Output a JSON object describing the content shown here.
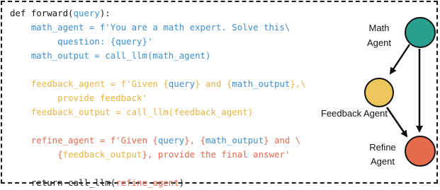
{
  "code": {
    "lines": [
      [
        {
          "t": "def forward(",
          "c": "black"
        },
        {
          "t": "query",
          "c": "blue"
        },
        {
          "t": "):",
          "c": "black"
        }
      ],
      [
        {
          "t": "    math_agent = f'You are a math expert. Solve this\\",
          "c": "blue"
        }
      ],
      [
        {
          "t": "         question: {",
          "c": "blue"
        },
        {
          "t": "query",
          "c": "blue"
        },
        {
          "t": "}'",
          "c": "blue"
        }
      ],
      [
        {
          "t": "    math_output = call_llm(math_agent)",
          "c": "blue"
        }
      ],
      [
        {
          "t": "",
          "c": "black"
        }
      ],
      [
        {
          "t": "    feedback_agent = f'Given {",
          "c": "yellow"
        },
        {
          "t": "query",
          "c": "blue"
        },
        {
          "t": "} and {",
          "c": "yellow"
        },
        {
          "t": "math_output",
          "c": "blue"
        },
        {
          "t": "},\\",
          "c": "yellow"
        }
      ],
      [
        {
          "t": "         provide feedback'",
          "c": "yellow"
        }
      ],
      [
        {
          "t": "    feedback_output = call_llm(feedback_agent)",
          "c": "yellow"
        }
      ],
      [
        {
          "t": "",
          "c": "black"
        }
      ],
      [
        {
          "t": "    refine_agent = f'Given {",
          "c": "orange"
        },
        {
          "t": "query",
          "c": "blue"
        },
        {
          "t": "}, {",
          "c": "orange"
        },
        {
          "t": "math_output",
          "c": "blue"
        },
        {
          "t": "} and \\",
          "c": "orange"
        }
      ],
      [
        {
          "t": "         {",
          "c": "orange"
        },
        {
          "t": "feedback_output",
          "c": "yellow"
        },
        {
          "t": "}, provide the final answer'",
          "c": "orange"
        }
      ],
      [
        {
          "t": "",
          "c": "black"
        }
      ],
      [
        {
          "t": "    return call_llm(",
          "c": "black"
        },
        {
          "t": "refine_agent",
          "c": "orange"
        },
        {
          "t": ")",
          "c": "black"
        }
      ]
    ]
  },
  "diagram": {
    "nodes": [
      {
        "id": "math",
        "label_lines": [
          "Math",
          "Agent"
        ],
        "color": "#27a08e"
      },
      {
        "id": "feedback",
        "label_lines": [
          "Feedback Agent"
        ],
        "color": "#ecc65a"
      },
      {
        "id": "refine",
        "label_lines": [
          "Refine",
          "Agent"
        ],
        "color": "#e76a4c"
      }
    ],
    "edges": [
      {
        "from": "math",
        "to": "feedback"
      },
      {
        "from": "math",
        "to": "refine"
      },
      {
        "from": "feedback",
        "to": "refine"
      }
    ]
  }
}
